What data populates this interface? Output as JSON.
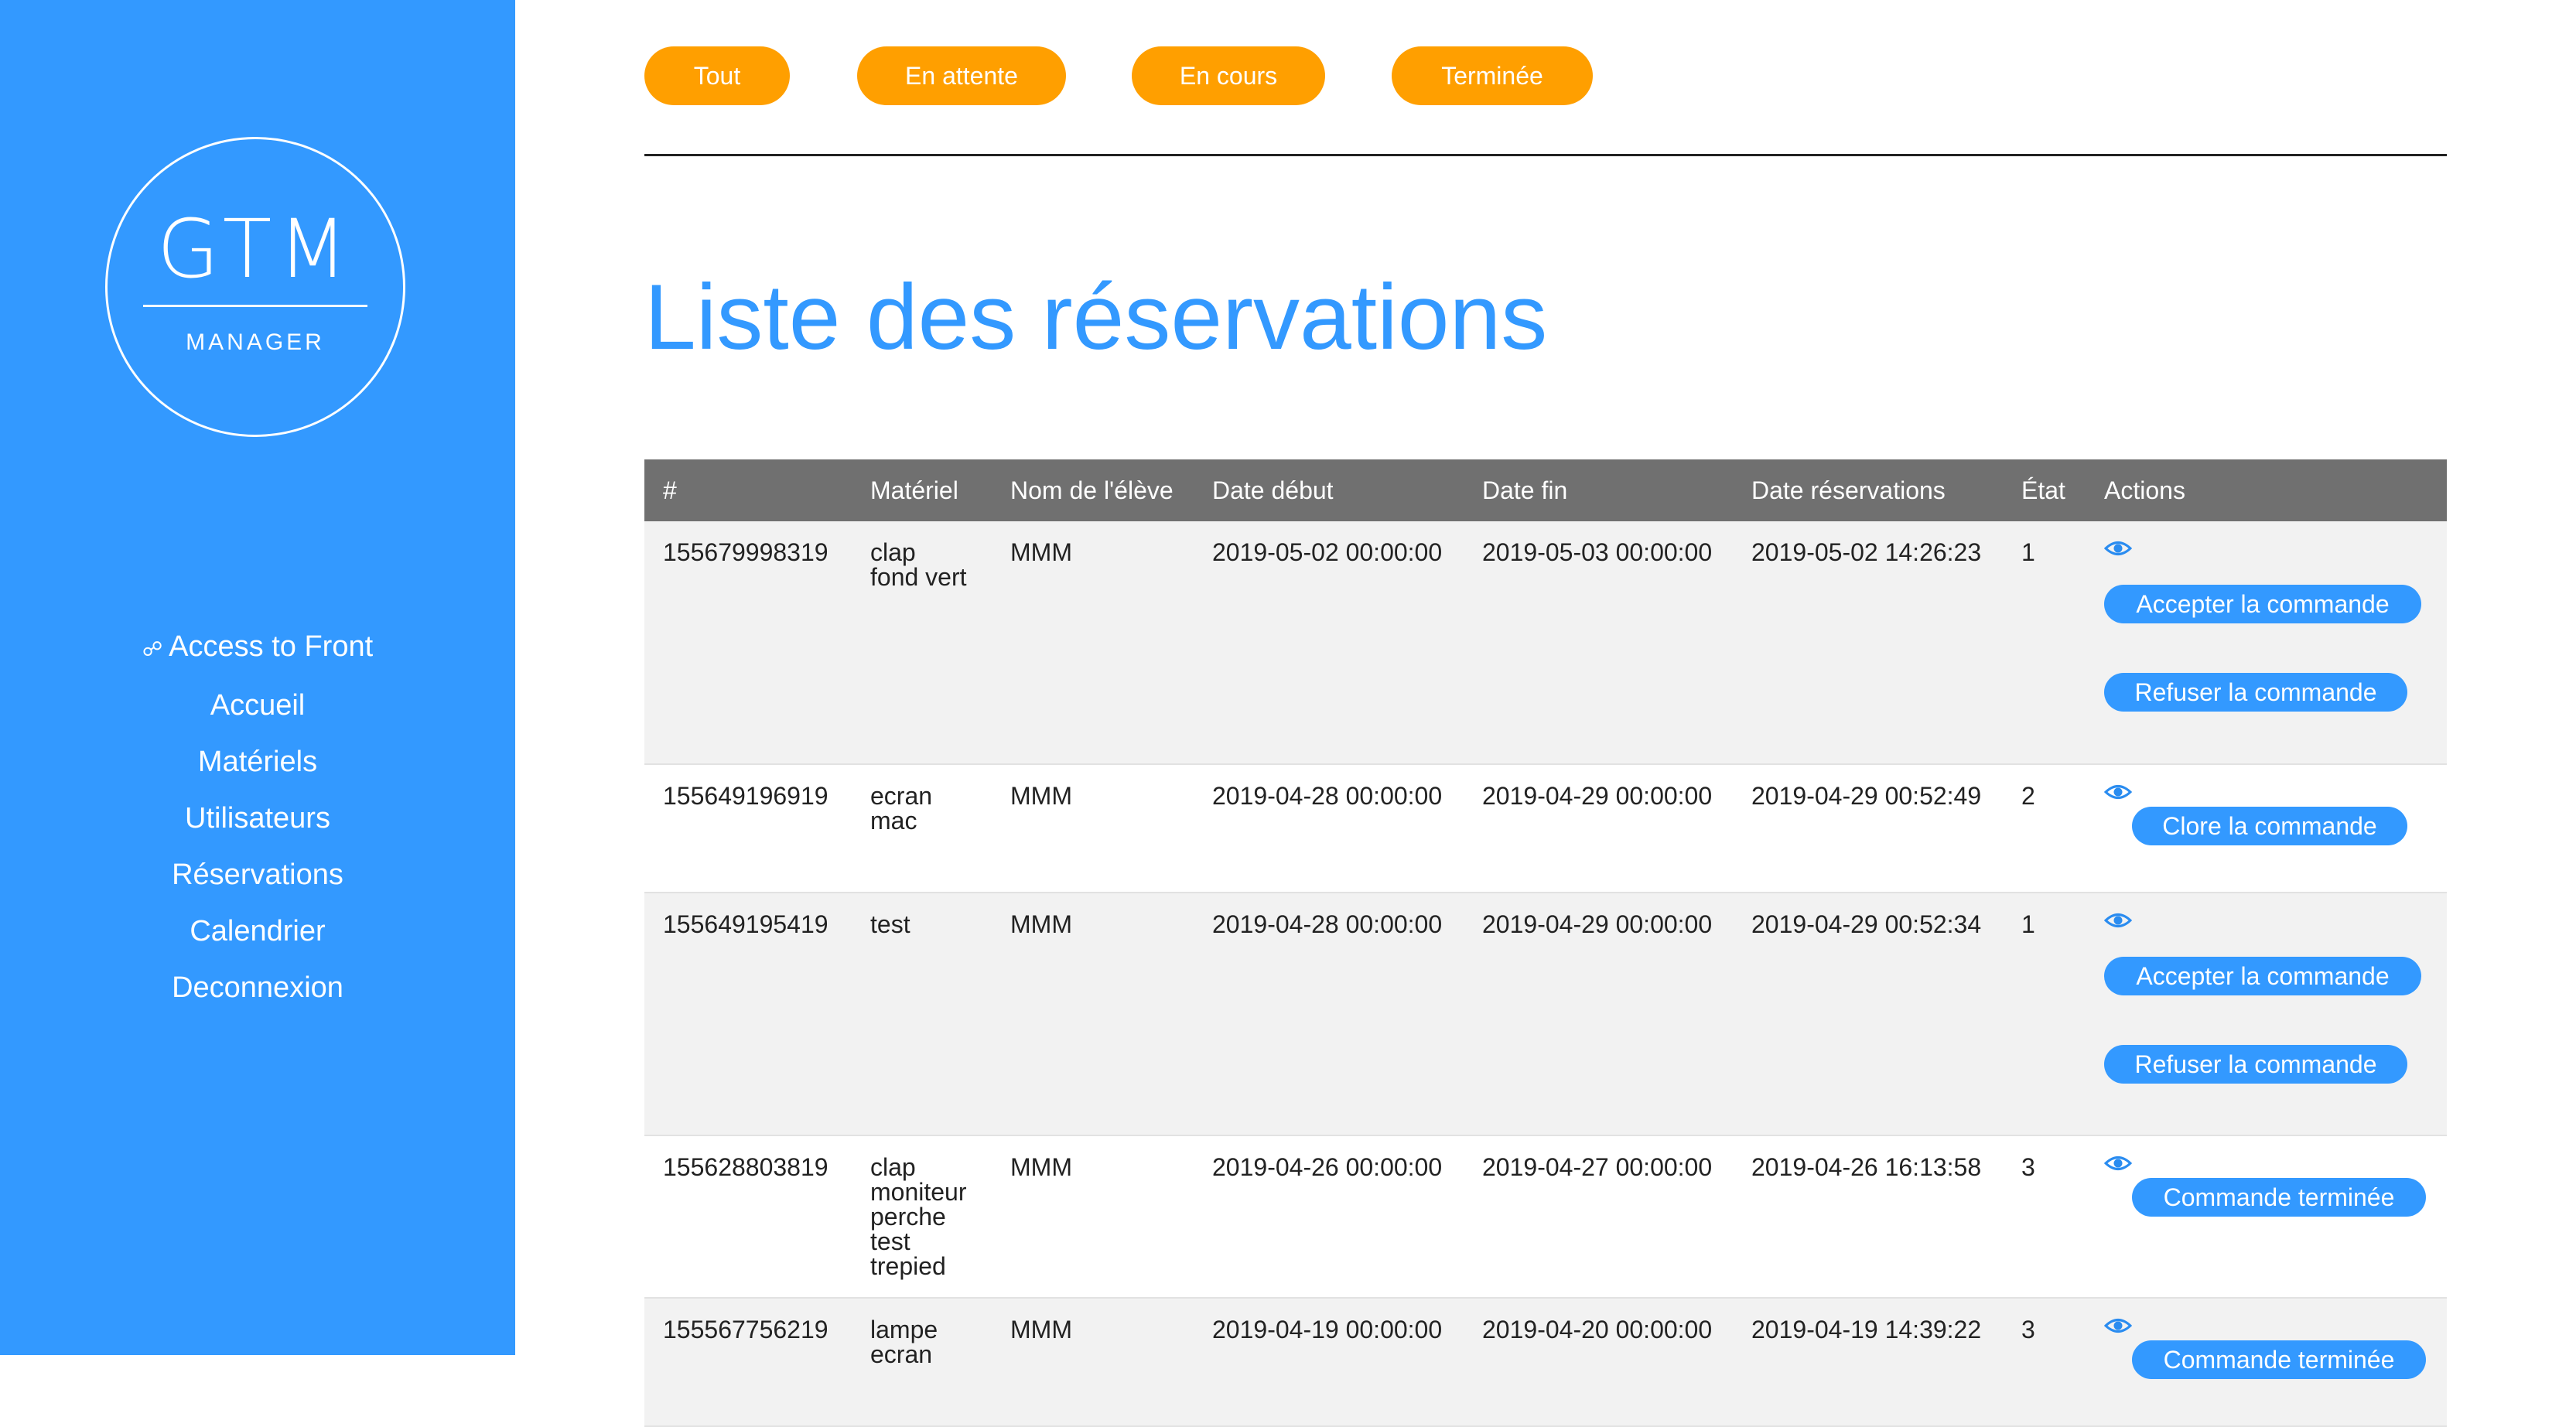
{
  "sidebar": {
    "logo": {
      "main": "GTM",
      "sub": "MANAGER"
    },
    "items": [
      {
        "icon": "link-icon",
        "label": "Access to Front"
      },
      {
        "label": "Accueil"
      },
      {
        "label": "Matériels"
      },
      {
        "label": "Utilisateurs"
      },
      {
        "label": "Réservations"
      },
      {
        "label": "Calendrier"
      },
      {
        "label": "Deconnexion"
      }
    ]
  },
  "filters": [
    {
      "label": "Tout"
    },
    {
      "label": "En attente"
    },
    {
      "label": "En cours"
    },
    {
      "label": "Terminée"
    }
  ],
  "page_title": "Liste des réservations",
  "table": {
    "headers": [
      "#",
      "Matériel",
      "Nom de l'élève",
      "Date début",
      "Date fin",
      "Date réservations",
      "État",
      "Actions"
    ],
    "rows": [
      {
        "id": "155679998319",
        "materiel": [
          "clap",
          "fond vert"
        ],
        "eleve": "MMM",
        "debut": "2019-05-02 00:00:00",
        "fin": "2019-05-03 00:00:00",
        "reservation": "2019-05-02 14:26:23",
        "etat": "1",
        "actions": [
          "Accepter la commande",
          "Refuser la commande"
        ]
      },
      {
        "id": "155649196919",
        "materiel": [
          "ecran",
          "mac"
        ],
        "eleve": "MMM",
        "debut": "2019-04-28 00:00:00",
        "fin": "2019-04-29 00:00:00",
        "reservation": "2019-04-29 00:52:49",
        "etat": "2",
        "actions": [
          "Clore la commande"
        ]
      },
      {
        "id": "155649195419",
        "materiel": [
          "test"
        ],
        "eleve": "MMM",
        "debut": "2019-04-28 00:00:00",
        "fin": "2019-04-29 00:00:00",
        "reservation": "2019-04-29 00:52:34",
        "etat": "1",
        "actions": [
          "Accepter la commande",
          "Refuser la commande"
        ]
      },
      {
        "id": "155628803819",
        "materiel": [
          "clap",
          "moniteur",
          "perche",
          "test",
          "trepied"
        ],
        "eleve": "MMM",
        "debut": "2019-04-26 00:00:00",
        "fin": "2019-04-27 00:00:00",
        "reservation": "2019-04-26 16:13:58",
        "etat": "3",
        "actions": [
          "Commande terminée"
        ]
      },
      {
        "id": "155567756219",
        "materiel": [
          "lampe",
          "ecran"
        ],
        "eleve": "MMM",
        "debut": "2019-04-19 00:00:00",
        "fin": "2019-04-20 00:00:00",
        "reservation": "2019-04-19 14:39:22",
        "etat": "3",
        "actions": [
          "Commande terminée"
        ]
      }
    ]
  },
  "colors": {
    "sidebar": "#3399ff",
    "accent_orange": "#ff9f00",
    "table_header": "#707070",
    "row_alt": "#f2f2f2"
  }
}
